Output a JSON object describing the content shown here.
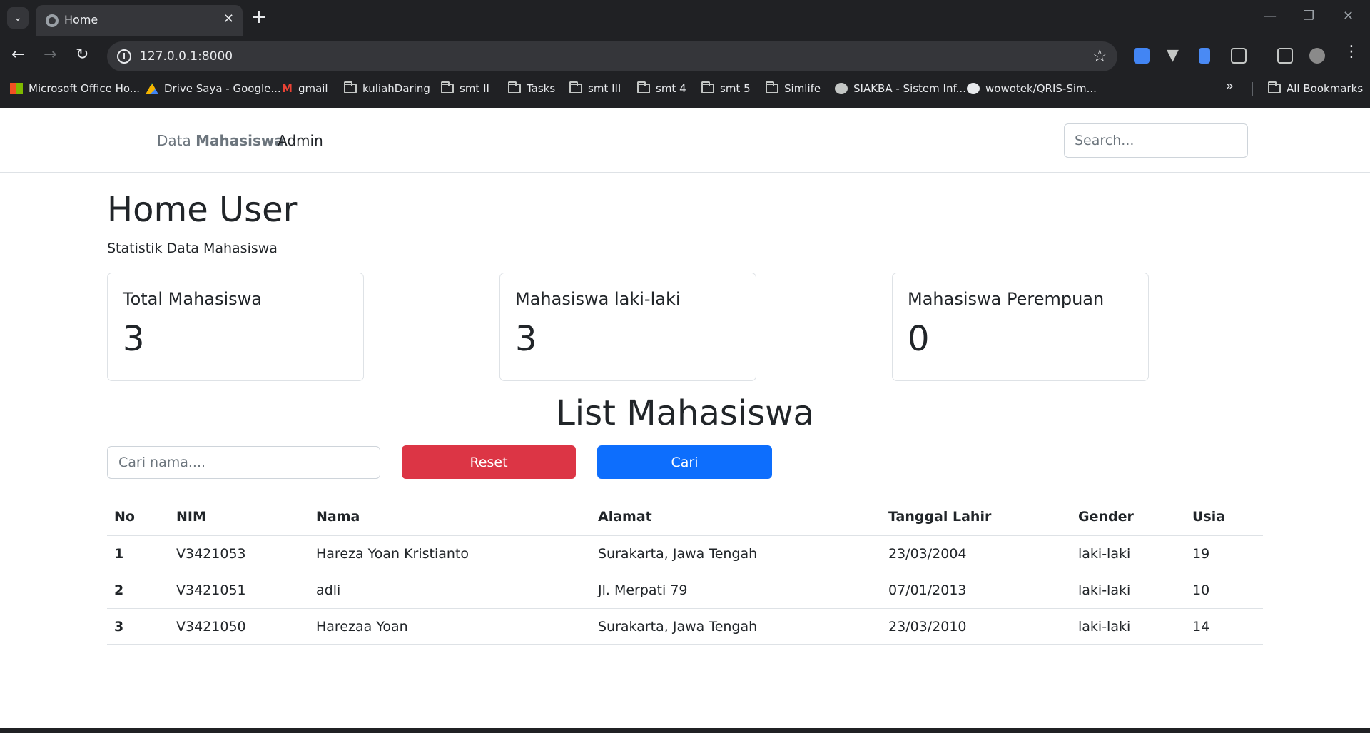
{
  "browser": {
    "tab_title": "Home",
    "url": "127.0.0.1:8000",
    "bookmarks": [
      {
        "label": "Microsoft Office Ho...",
        "icon": "ms-office-icon"
      },
      {
        "label": "Drive Saya - Google...",
        "icon": "google-drive-icon"
      },
      {
        "label": "gmail",
        "icon": "gmail-icon"
      },
      {
        "label": "kuliahDaring",
        "icon": "folder-icon"
      },
      {
        "label": "smt II",
        "icon": "folder-icon"
      },
      {
        "label": "Tasks",
        "icon": "folder-icon"
      },
      {
        "label": "smt III",
        "icon": "folder-icon"
      },
      {
        "label": "smt 4",
        "icon": "folder-icon"
      },
      {
        "label": "smt 5",
        "icon": "folder-icon"
      },
      {
        "label": "Simlife",
        "icon": "folder-icon"
      },
      {
        "label": "SIAKBA - Sistem Inf...",
        "icon": "globe-icon"
      },
      {
        "label": "wowotek/QRIS-Sim...",
        "icon": "github-icon"
      }
    ],
    "all_bookmarks": "All Bookmarks"
  },
  "navbar": {
    "brand_prefix": "Data ",
    "brand_bold": "Mahasiswa",
    "admin_link": "Admin",
    "search_placeholder": "Search..."
  },
  "header": {
    "title": "Home User",
    "subtitle": "Statistik Data Mahasiswa"
  },
  "stats": [
    {
      "label": "Total Mahasiswa",
      "value": "3"
    },
    {
      "label": "Mahasiswa laki-laki",
      "value": "3"
    },
    {
      "label": "Mahasiswa Perempuan",
      "value": "0"
    }
  ],
  "list": {
    "title": "List Mahasiswa",
    "search_placeholder": "Cari nama....",
    "reset_label": "Reset",
    "cari_label": "Cari",
    "columns": [
      "No",
      "NIM",
      "Nama",
      "Alamat",
      "Tanggal Lahir",
      "Gender",
      "Usia"
    ],
    "rows": [
      [
        "1",
        "V3421053",
        "Hareza Yoan Kristianto",
        "Surakarta, Jawa Tengah",
        "23/03/2004",
        "laki-laki",
        "19"
      ],
      [
        "2",
        "V3421051",
        "adli",
        "Jl. Merpati 79",
        "07/01/2013",
        "laki-laki",
        "10"
      ],
      [
        "3",
        "V3421050",
        "Harezaa Yoan",
        "Surakarta, Jawa Tengah",
        "23/03/2010",
        "laki-laki",
        "14"
      ]
    ]
  },
  "colors": {
    "reset": "#dc3545",
    "cari": "#0d6efd",
    "chrome_bg": "#202124"
  }
}
